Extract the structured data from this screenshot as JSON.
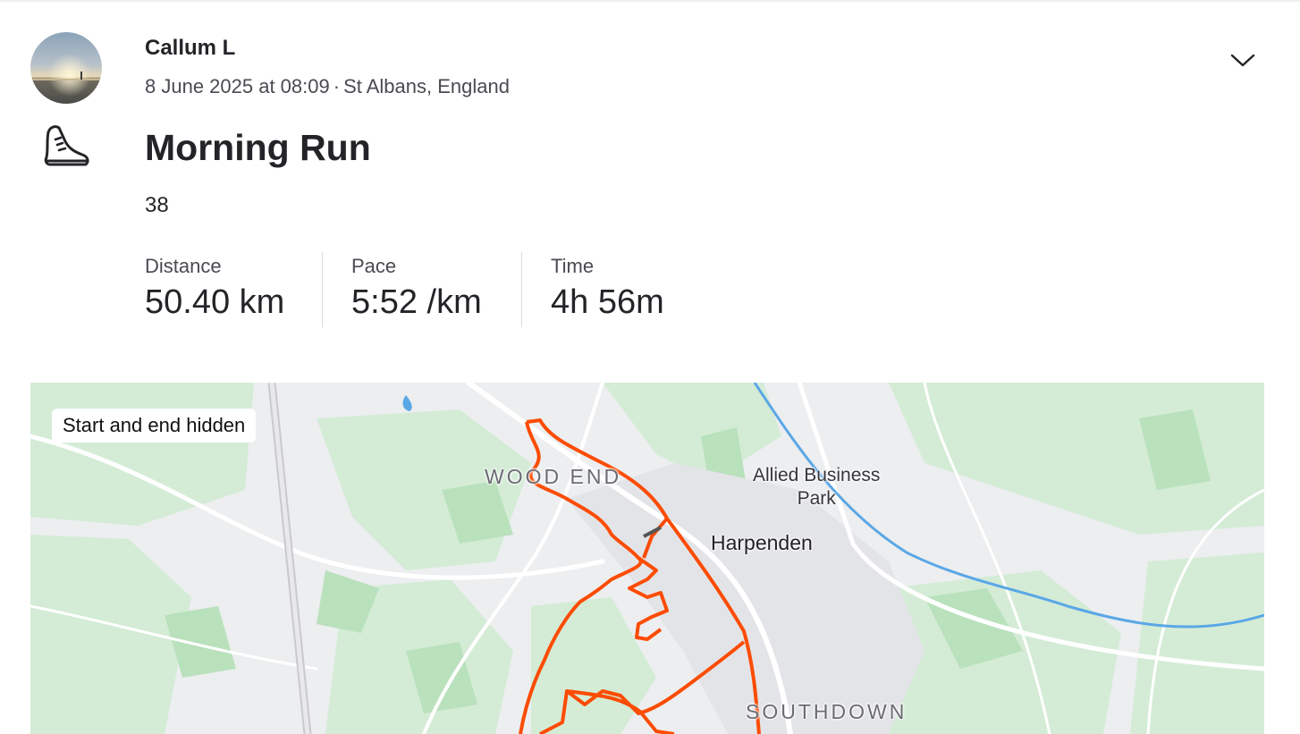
{
  "athlete": {
    "name": "Callum L"
  },
  "activity": {
    "date_time": "8 June 2025 at 08:09",
    "separator": "·",
    "location": "St Albans, England",
    "title": "Morning Run",
    "sport_icon": "running-shoe-icon",
    "kudos_count": "38"
  },
  "stats": [
    {
      "label": "Distance",
      "value": "50.40 km"
    },
    {
      "label": "Pace",
      "value": "5:52 /km"
    },
    {
      "label": "Time",
      "value": "4h 56m"
    }
  ],
  "map": {
    "privacy_badge": "Start and end hidden",
    "labels": {
      "wood_end": "WOOD END",
      "allied_line1": "Allied Business",
      "allied_line2": "Park",
      "harpenden": "Harpenden",
      "southdown": "SOUTHDOWN"
    },
    "route_color": "#fc4c02",
    "river_color": "#5aa7e6"
  },
  "menu_icon": "chevron-down-icon"
}
